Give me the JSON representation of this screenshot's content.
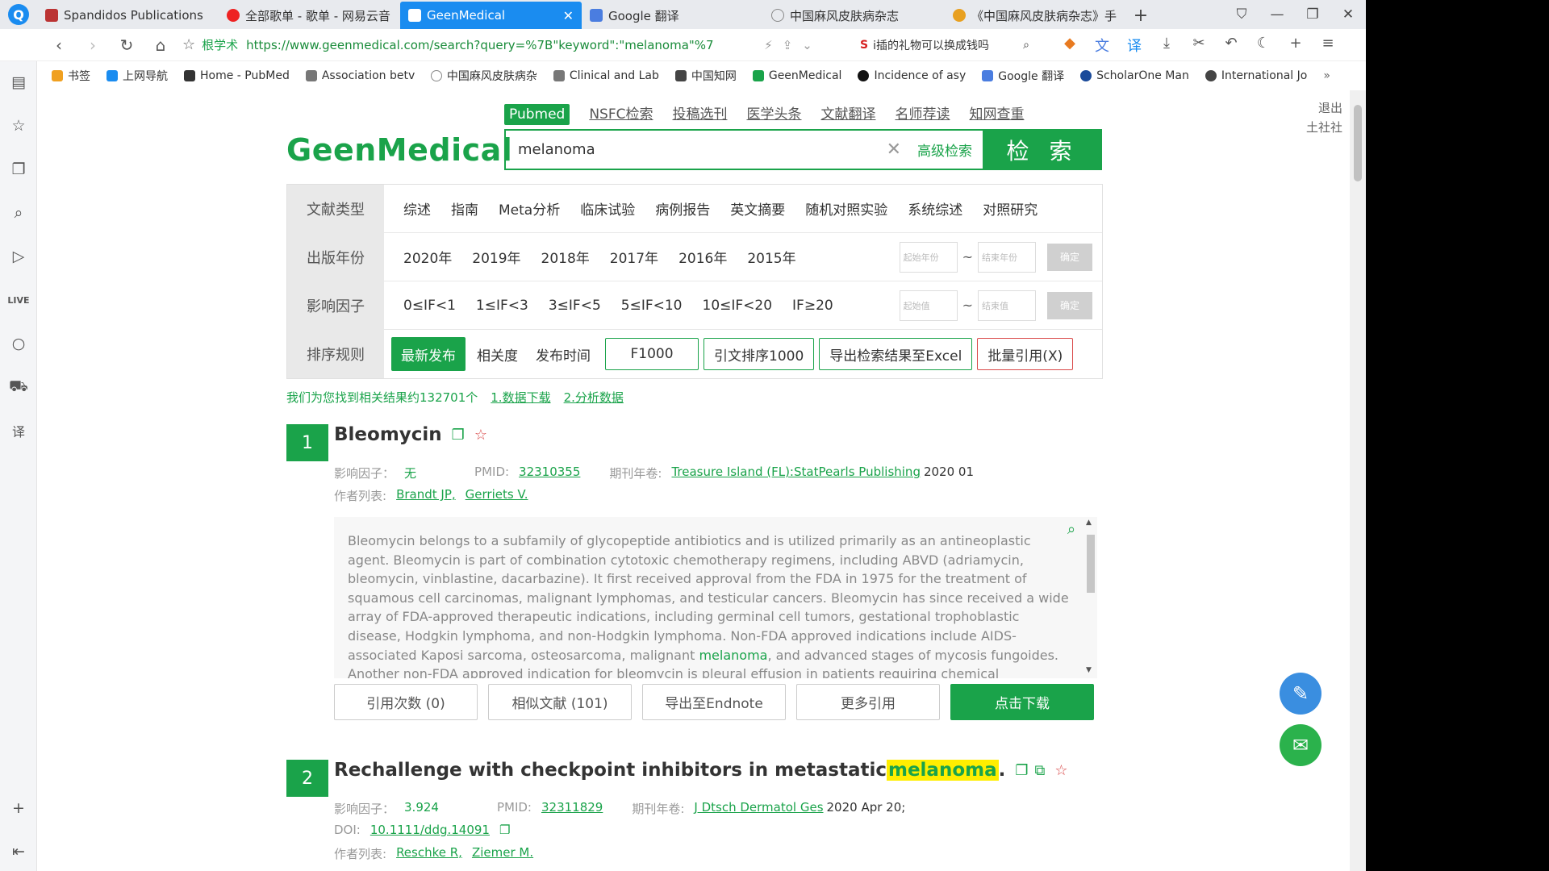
{
  "browser": {
    "tabs": [
      {
        "label": "Spandidos Publications",
        "color": "#b33",
        "active": false
      },
      {
        "label": "全部歌单 - 歌单 - 网易云音",
        "color": "#e22",
        "active": false
      },
      {
        "label": "GeenMedical",
        "color": "#1aa34a",
        "active": true
      },
      {
        "label": "Google 翻译",
        "color": "#4a7de0",
        "active": false
      },
      {
        "label": "中国麻风皮肤病杂志",
        "color": "#888",
        "active": false
      },
      {
        "label": "《中国麻风皮肤病杂志》手",
        "color": "#e8a020",
        "active": false
      }
    ],
    "url_secure_label": "根学术",
    "url": "https://www.geenmedical.com/search?query=%7B\"keyword\":\"melanoma\"%7",
    "search_text": "i插的礼物可以换成钱吗",
    "bookmarks": [
      {
        "label": "书签",
        "color": "#f0a020"
      },
      {
        "label": "上网导航",
        "color": "#1a8cf0"
      },
      {
        "label": "Home - PubMed",
        "color": "#333"
      },
      {
        "label": "Association betv",
        "color": "#555"
      },
      {
        "label": "中国麻风皮肤病杂",
        "color": "#888"
      },
      {
        "label": "Clinical and Lab",
        "color": "#555"
      },
      {
        "label": "中国知网",
        "color": "#444"
      },
      {
        "label": "GeenMedical",
        "color": "#1aa34a"
      },
      {
        "label": "Incidence of asy",
        "color": "#222"
      },
      {
        "label": "Google 翻译",
        "color": "#4a7de0"
      },
      {
        "label": "ScholarOne Man",
        "color": "#1a4a9a"
      },
      {
        "label": "International Jo",
        "color": "#444"
      }
    ]
  },
  "site": {
    "logo": "GeenMedical",
    "logout": "退出",
    "user": "土社社",
    "nav": [
      "Pubmed",
      "NSFC检索",
      "投稿选刊",
      "医学头条",
      "文献翻译",
      "名师荐读",
      "知网查重"
    ],
    "search_query": "melanoma",
    "advanced": "高级检索",
    "search_button": "检 索"
  },
  "filters": {
    "doc_type": {
      "label": "文献类型",
      "options": [
        "综述",
        "指南",
        "Meta分析",
        "临床试验",
        "病例报告",
        "英文摘要",
        "随机对照实验",
        "系统综述",
        "对照研究"
      ]
    },
    "year": {
      "label": "出版年份",
      "options": [
        "2020年",
        "2019年",
        "2018年",
        "2017年",
        "2016年",
        "2015年"
      ],
      "start_placeholder": "起始年份",
      "end_placeholder": "结束年份",
      "confirm": "确定"
    },
    "impact": {
      "label": "影响因子",
      "options": [
        "0≤IF<1",
        "1≤IF<3",
        "3≤IF<5",
        "5≤IF<10",
        "10≤IF<20",
        "IF≥20"
      ],
      "start_placeholder": "起始值",
      "end_placeholder": "结束值",
      "confirm": "确定"
    },
    "sort": {
      "label": "排序规则",
      "active": "最新发布",
      "options": [
        "相关度",
        "发布时间"
      ],
      "buttons": [
        "F1000",
        "引文排序1000",
        "导出检索结果至Excel",
        "批量引用(X)"
      ]
    }
  },
  "results_summary": {
    "text": "我们为您找到相关结果约132701个",
    "link1": "1.数据下载",
    "link2": "2.分析数据"
  },
  "results": [
    {
      "num": "1",
      "title": "Bleomycin",
      "if_label": "影响因子：",
      "if_value": "无",
      "pmid_label": "PMID:",
      "pmid": "32310355",
      "journal_label": "期刊年卷:",
      "journal": "Treasure Island (FL):StatPearls Publishing",
      "journal_date": "2020 01",
      "authors_label": "作者列表:",
      "authors": [
        "Brandt JP,",
        "Gerriets V."
      ],
      "abstract_before": "Bleomycin belongs to a subfamily of glycopeptide antibiotics and is utilized primarily as an antineoplastic agent. Bleomycin is part of combination cytotoxic chemotherapy regimens, including ABVD (adriamycin, bleomycin, vinblastine, dacarbazine). It first received approval from the FDA in 1975 for the treatment of squamous cell carcinomas, malignant lymphomas, and testicular cancers. Bleomycin has since received a wide array of FDA-approved therapeutic indications, including germinal cell tumors, gestational trophoblastic disease, Hodgkin lymphoma, and non-Hodgkin lymphoma. Non-FDA approved indications include AIDS-associated Kaposi sarcoma, osteosarcoma, malignant ",
      "abstract_highlight": "melanoma",
      "abstract_after": ", and advanced stages of mycosis fungoides. Another non-FDA approved indication for bleomycin is pleural effusion in patients requiring chemical pleurodesis due to metastatic",
      "actions": [
        "引用次数 (0)",
        "相似文献 (101)",
        "导出至Endnote",
        "更多引用",
        "点击下载"
      ]
    },
    {
      "num": "2",
      "title_before": "Rechallenge with checkpoint inhibitors in metastatic ",
      "title_highlight": "melanoma",
      "title_after": ".",
      "if_label": "影响因子：",
      "if_value": "3.924",
      "pmid_label": "PMID:",
      "pmid": "32311829",
      "journal_label": "期刊年卷:",
      "journal": "J Dtsch Dermatol Ges",
      "journal_date": "2020 Apr 20;",
      "doi_label": "DOI:",
      "doi": "10.1111/ddg.14091",
      "authors_label": "作者列表:",
      "authors": [
        "Reschke R,",
        "Ziemer M."
      ]
    }
  ]
}
